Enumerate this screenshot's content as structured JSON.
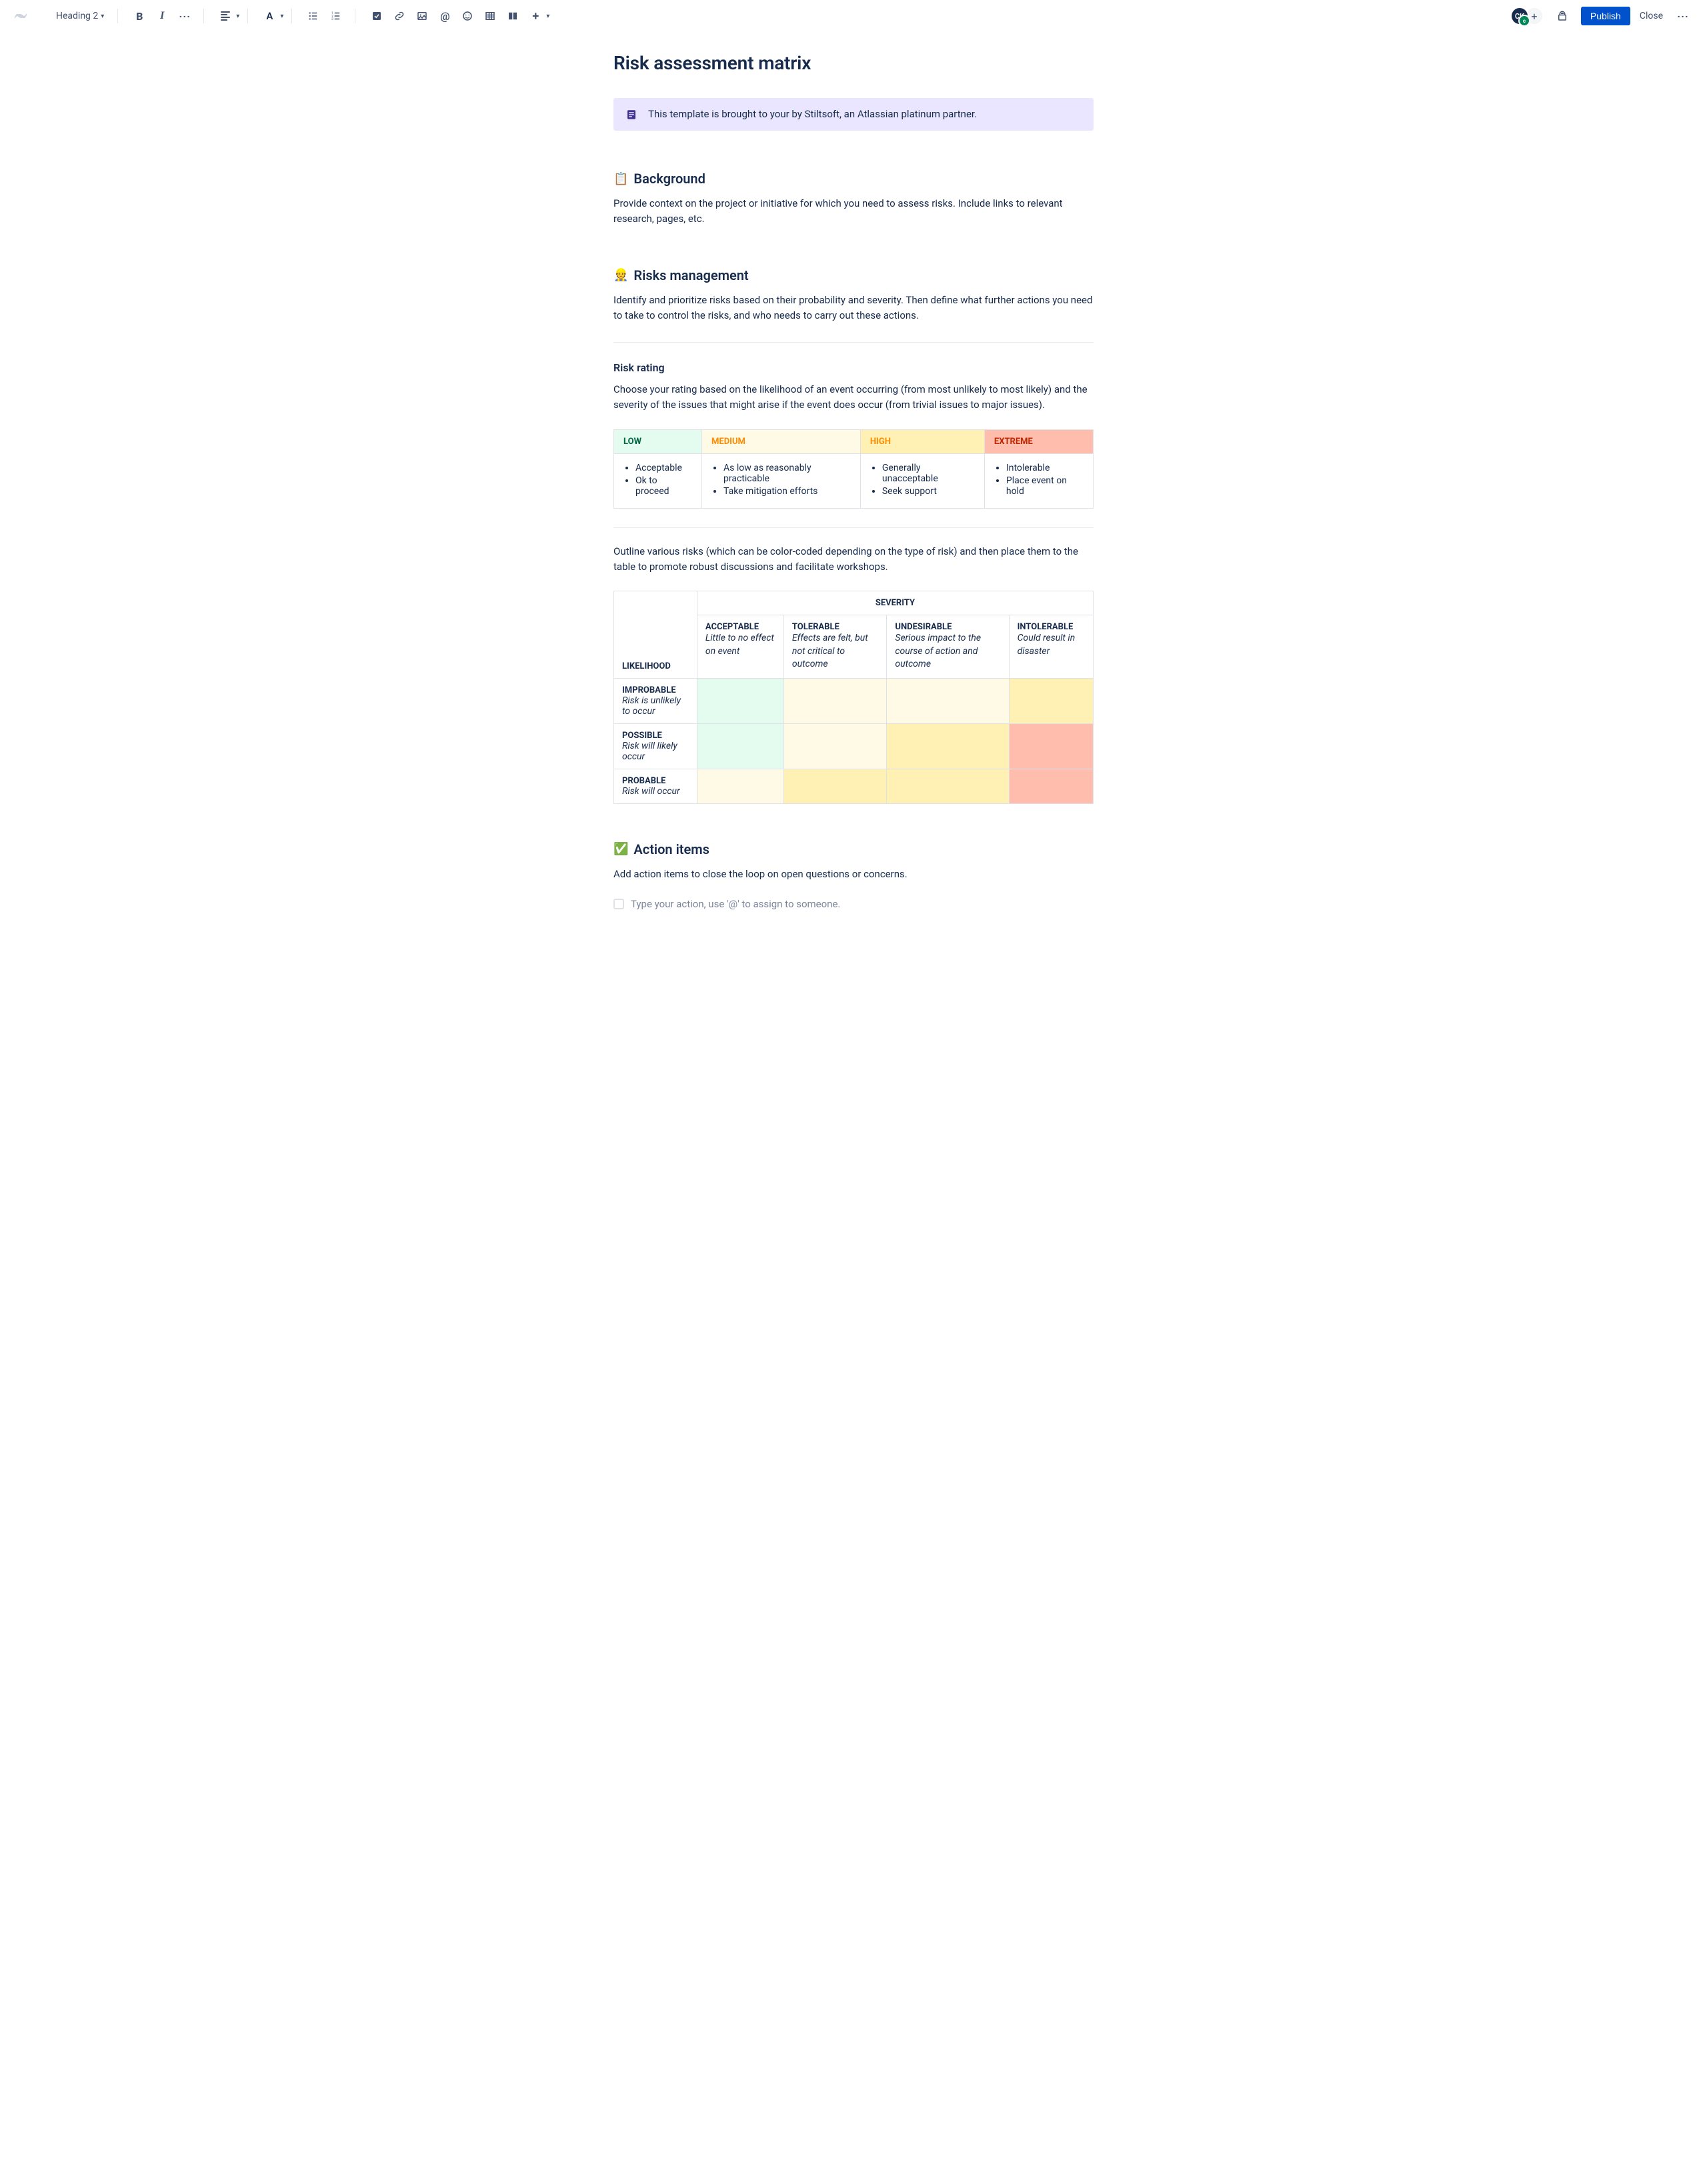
{
  "toolbar": {
    "style_select": "Heading 2",
    "avatar_initials": "CK",
    "publish_label": "Publish",
    "close_label": "Close"
  },
  "page_title": "Risk assessment matrix",
  "note_panel": "This template is brought to your by Stiltsoft, an Atlassian platinum partner.",
  "background": {
    "emoji": "📋",
    "heading": "Background",
    "body": "Provide context on the project or initiative for which you need to assess risks. Include links to relevant research, pages, etc."
  },
  "risks_mgmt": {
    "emoji": "👷",
    "heading": "Risks management",
    "body": "Identify and prioritize risks based on their probability and severity. Then define what further actions you need to take to control the risks, and who needs to carry out these actions."
  },
  "risk_rating": {
    "heading": "Risk rating",
    "body": "Choose your rating based on the likelihood of an event occurring (from most unlikely to most likely) and the severity of the issues that might arise if the event does occur (from trivial issues to major issues).",
    "levels": [
      {
        "label": "LOW",
        "items": [
          "Acceptable",
          "Ok to proceed"
        ]
      },
      {
        "label": "MEDIUM",
        "items": [
          "As low as reasonably practicable",
          "Take mitigation efforts"
        ]
      },
      {
        "label": "HIGH",
        "items": [
          "Generally unacceptable",
          "Seek support"
        ]
      },
      {
        "label": "EXTREME",
        "items": [
          "Intolerable",
          "Place event on hold"
        ]
      }
    ]
  },
  "matrix_intro": "Outline various risks (which can be color-coded depending on the type of risk) and then place them to the table to promote robust discussions and facilitate workshops.",
  "matrix": {
    "severity_label": "SEVERITY",
    "likelihood_label": "LIKELIHOOD",
    "severity_cols": [
      {
        "title": "ACCEPTABLE",
        "desc": "Little to no effect on event"
      },
      {
        "title": "TOLERABLE",
        "desc": "Effects are felt, but not critical to outcome"
      },
      {
        "title": "UNDESIRABLE",
        "desc": "Serious impact to the course of action and outcome"
      },
      {
        "title": "INTOLERABLE",
        "desc": "Could result in disaster"
      }
    ],
    "likelihood_rows": [
      {
        "title": "IMPROBABLE",
        "desc": "Risk is unlikely to occur"
      },
      {
        "title": "POSSIBLE",
        "desc": "Risk will likely occur"
      },
      {
        "title": "PROBABLE",
        "desc": "Risk will occur"
      }
    ]
  },
  "action_items": {
    "emoji": "✅",
    "heading": "Action items",
    "body": "Add action items to close the loop on open questions or concerns.",
    "placeholder": "Type your action, use '@' to assign to someone."
  }
}
